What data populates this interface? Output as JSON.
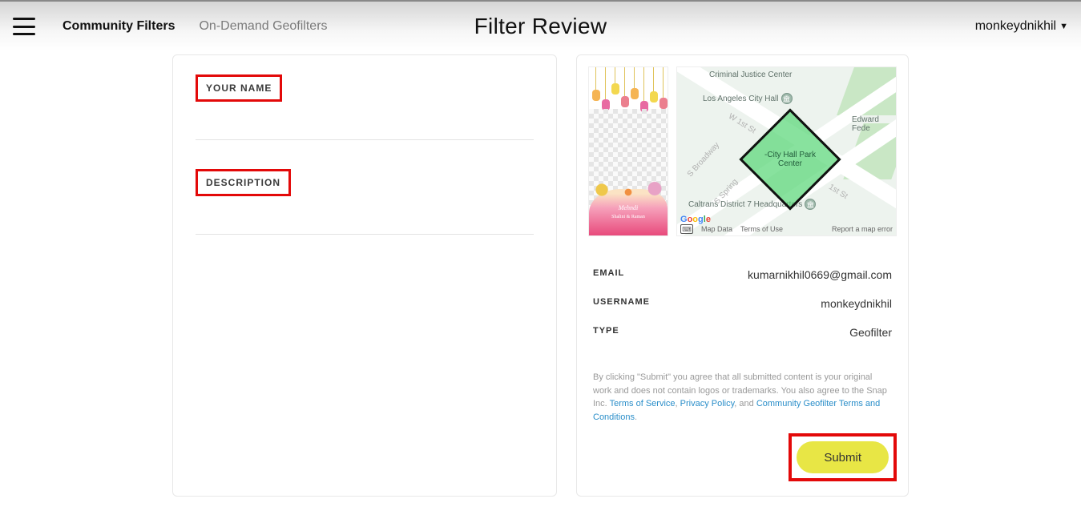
{
  "header": {
    "title": "Filter Review",
    "user": "monkeydnikhil",
    "nav": {
      "community": "Community Filters",
      "ondemand": "On-Demand Geofilters"
    }
  },
  "left": {
    "name_label": "YOUR NAME",
    "desc_label": "DESCRIPTION"
  },
  "map": {
    "pois": {
      "criminal": "Criminal Justice Center",
      "cityhall": "Los Angeles City Hall",
      "caltrans": "Caltrans District 7 Headquarters",
      "edward": "Edward Fede"
    },
    "roads": {
      "w1st": "W 1st St",
      "broadway": "S Broadway",
      "spring": "S Spring",
      "first_e": "1st St"
    },
    "geofence": "-City Hall Park Center",
    "credits": {
      "mapdata": "Map Data",
      "terms": "Terms of Use",
      "report": "Report a map error"
    }
  },
  "preview": {
    "title": "Mehndi",
    "subtitle": "Shalini & Raman"
  },
  "info": {
    "email_k": "EMAIL",
    "email_v": "kumarnikhil0669@gmail.com",
    "user_k": "USERNAME",
    "user_v": "monkeydnikhil",
    "type_k": "TYPE",
    "type_v": "Geofilter"
  },
  "disclaimer": {
    "t1": "By clicking \"Submit\" you agree that all submitted content is your original work and does not contain logos or trademarks. You also agree to the Snap Inc. ",
    "terms": "Terms of Service",
    "sep1": ", ",
    "privacy": "Privacy Policy",
    "sep2": ", and ",
    "community": "Community Geofilter Terms and Conditions",
    "end": "."
  },
  "submit": "Submit"
}
